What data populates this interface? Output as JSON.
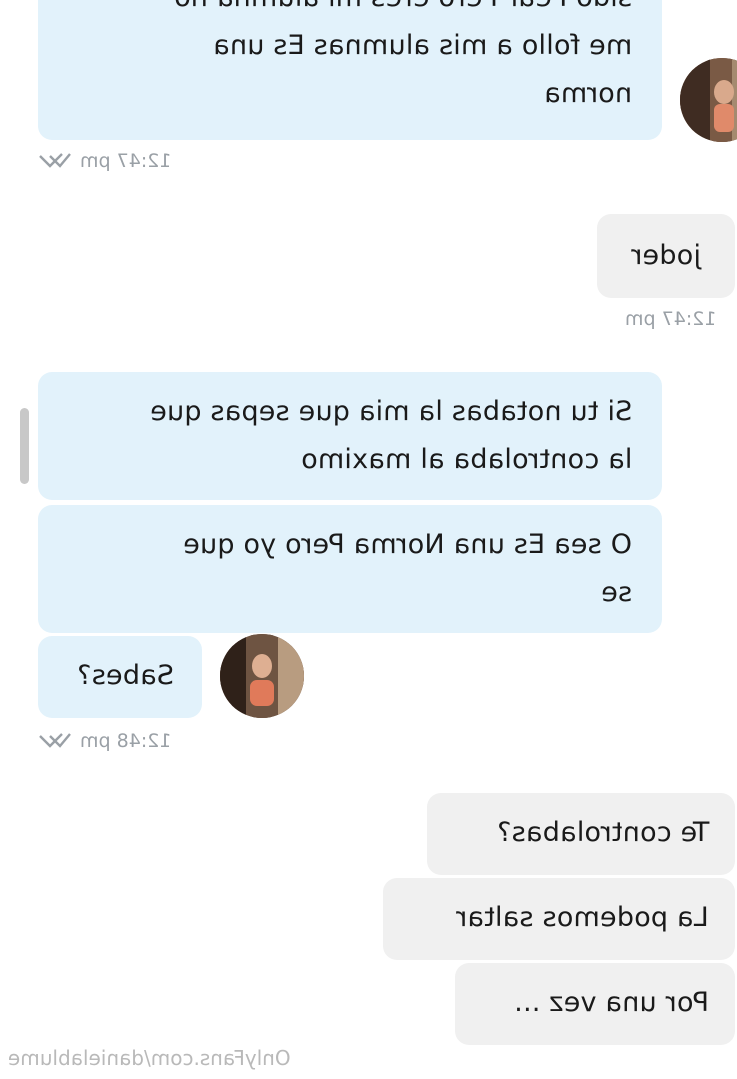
{
  "messages": {
    "m1": {
      "line0": "sido Pear Pero eres mi alumna no",
      "line1": "me follo a mis alumnas Es una",
      "line2": "norma",
      "time": "12:47 pm"
    },
    "m2": {
      "text": "joder",
      "time": "12:47 pm"
    },
    "m3": {
      "line1": "Si tu notabas la mia que sepas que",
      "line2": "la controlaba al maximo"
    },
    "m4": {
      "line1": "O sea Es una Norma Pero yo que",
      "line2": "se"
    },
    "m5": {
      "text": "Sabes?",
      "time": "12:48 pm"
    },
    "m6": {
      "text": "Te controlabas?"
    },
    "m7": {
      "text": "La podemos saltar"
    },
    "m8": {
      "text": "Por una vez ..."
    }
  },
  "watermark": "OnlyFans.com/danielablume",
  "colors": {
    "incoming": "#e2f2fb",
    "outgoing": "#f0f0f0",
    "meta": "#9aa0a6"
  },
  "icons": {
    "read_receipt": "double-check-icon",
    "avatar": "profile-photo"
  }
}
